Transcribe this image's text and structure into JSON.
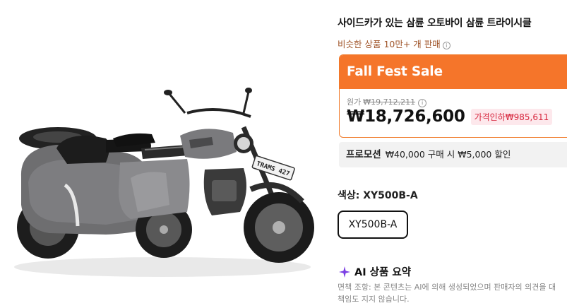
{
  "product": {
    "title": "사이드카가 있는 삼륜 오토바이 삼륜 트라이시클",
    "sold_text": "비슷한 상품 10만+ 개 판매",
    "image_plate_text": "TRAMS 427"
  },
  "sale": {
    "banner": "Fall Fest Sale",
    "original_label": "원가",
    "original_price": "₩19,712,211",
    "price": "₩18,726,600",
    "discount": "가격인하₩985,611",
    "accent_color": "#f5752a"
  },
  "promotion": {
    "label": "프로모션",
    "text": "₩40,000 구매 시 ₩5,000 할인"
  },
  "options": {
    "color_label": "색상: XY500B-A",
    "selected_option": "XY500B-A"
  },
  "ai_summary": {
    "title": "AI 상품 요약",
    "disclaimer_line1": "면책 조항: 본 콘텐츠는 AI에 의해 생성되었으며 판매자의 의견을 대",
    "disclaimer_line2": "책임도 지지 않습니다."
  },
  "icons": {
    "info": "info-icon",
    "sparkle": "sparkle-icon"
  }
}
